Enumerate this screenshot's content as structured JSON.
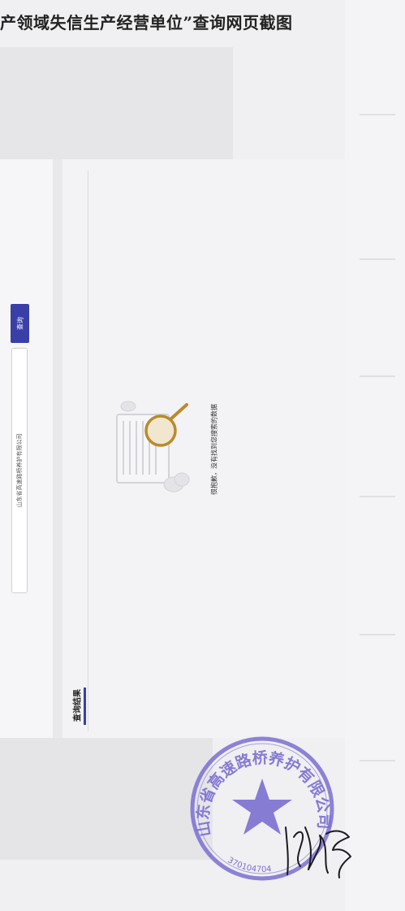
{
  "caption": "产领域失信生产经营单位”查询网页截图",
  "search": {
    "input_value": "山东省高速路桥养护有限公司",
    "button_label": "查询"
  },
  "results": {
    "tab_label": "查询结果",
    "empty_message": "很抱歉，没有找到您搜索的数据"
  },
  "seal": {
    "name": "山东省高速路桥养护有限公司",
    "code": "370104704",
    "color": "#7a6fd0"
  },
  "colors": {
    "accent": "#3a3fa8",
    "magnifier": "#b98a2e",
    "seal": "#7a6fd0"
  }
}
